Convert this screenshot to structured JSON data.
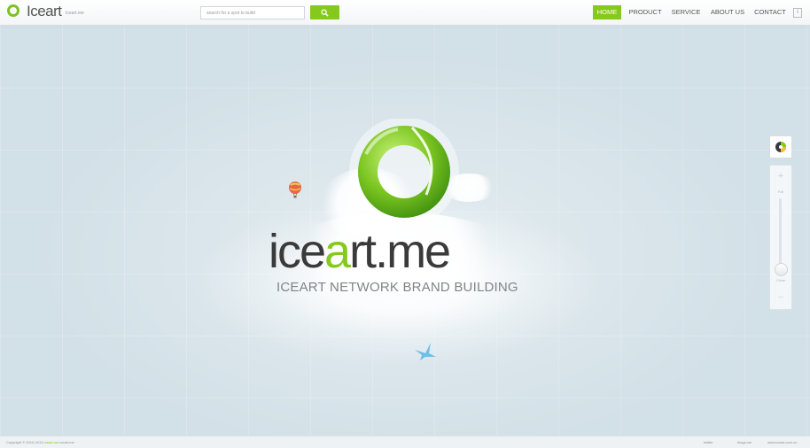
{
  "header": {
    "logo_text": "Iceart",
    "logo_sub": "Iceart.me",
    "search": {
      "placeholder": "search for a spot to build"
    },
    "nav": [
      {
        "label": "HOME",
        "active": true
      },
      {
        "label": "PRODUCT",
        "active": false
      },
      {
        "label": "SERVICE",
        "active": false
      },
      {
        "label": "ABOUT US",
        "active": false
      },
      {
        "label": "CONTACT",
        "active": false
      }
    ],
    "info_icon_label": "i"
  },
  "hero": {
    "wordmark_left": "ice",
    "wordmark_accent": "a",
    "wordmark_right": "rt.me",
    "tagline": "ICEART NETWORK BRAND BUILDING"
  },
  "side_panel": {
    "zoom_plus": "+",
    "zoom_top_label": "Full",
    "zoom_bottom_label": "Close",
    "zoom_minus": "—"
  },
  "footer": {
    "copyright_prefix": "Copyright © 2010-2013",
    "copyright_highlight": "Iceart.me",
    "copyright_suffix": "iceart.me",
    "links": [
      "twitter",
      "blogs.me",
      "www.iceart.com.cn"
    ]
  },
  "colors": {
    "accent": "#86c91e",
    "background": "#d8e4ea",
    "text": "#555555"
  },
  "icons": [
    "logo-ring-icon",
    "search-icon",
    "info-icon",
    "balloon-icon",
    "bird-icon",
    "avatar-icon",
    "zoom-plus-icon"
  ]
}
